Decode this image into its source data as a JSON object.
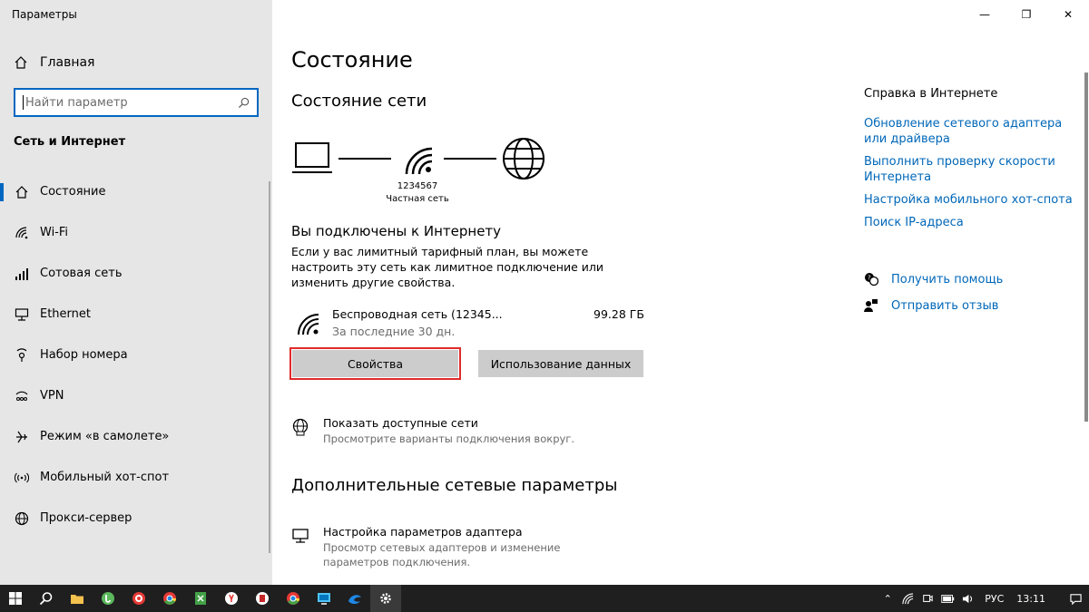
{
  "window": {
    "title": "Параметры",
    "minimize": "—",
    "maximize": "❐",
    "close": "✕"
  },
  "sidebar": {
    "home_label": "Главная",
    "search_placeholder": "Найти параметр",
    "section_title": "Сеть и Интернет",
    "items": [
      {
        "label": "Состояние",
        "icon": "home-icon"
      },
      {
        "label": "Wi-Fi",
        "icon": "wifi-icon"
      },
      {
        "label": "Сотовая сеть",
        "icon": "cellular-icon"
      },
      {
        "label": "Ethernet",
        "icon": "ethernet-icon"
      },
      {
        "label": "Набор номера",
        "icon": "dialup-icon"
      },
      {
        "label": "VPN",
        "icon": "vpn-icon"
      },
      {
        "label": "Режим «в самолете»",
        "icon": "airplane-icon"
      },
      {
        "label": "Мобильный хот-спот",
        "icon": "hotspot-icon"
      },
      {
        "label": "Прокси-сервер",
        "icon": "globe-icon"
      }
    ]
  },
  "main": {
    "title": "Состояние",
    "network_status_title": "Состояние сети",
    "network_name": "1234567",
    "network_type": "Частная сеть",
    "connected_title": "Вы подключены к Интернету",
    "description": "Если у вас лимитный тарифный план, вы можете настроить эту сеть как лимитное подключение или изменить другие свойства.",
    "connection": {
      "name": "Беспроводная сеть (12345...",
      "period": "За последние 30 дн.",
      "usage": "99.28 ГБ"
    },
    "buttons": {
      "properties": "Свойства",
      "data_usage": "Использование данных"
    },
    "show_networks": {
      "title": "Показать доступные сети",
      "subtitle": "Просмотрите варианты подключения вокруг."
    },
    "advanced_title": "Дополнительные сетевые параметры",
    "adapter": {
      "title": "Настройка параметров адаптера",
      "subtitle": "Просмотр сетевых адаптеров и изменение параметров подключения."
    }
  },
  "help": {
    "title": "Справка в Интернете",
    "links": [
      "Обновление сетевого адаптера или драйвера",
      "Выполнить проверку скорости Интернета",
      "Настройка мобильного хот-спота",
      "Поиск IP-адреса"
    ],
    "get_help": "Получить помощь",
    "feedback": "Отправить отзыв"
  },
  "taskbar": {
    "language": "РУС",
    "time": "13:11"
  },
  "colors": {
    "accent": "#0067c0",
    "link": "#0067b8",
    "highlight": "#e02b2b",
    "sidebar_bg": "#e6e6e6",
    "taskbar_bg": "#1f1f1f"
  }
}
